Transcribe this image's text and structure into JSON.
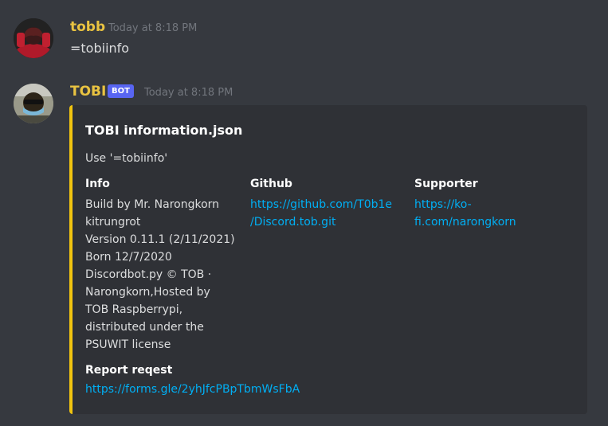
{
  "messages": [
    {
      "author": "tobb",
      "timestamp": "Today at 8:18 PM",
      "content": "=tobiinfo"
    },
    {
      "author": "TOBI",
      "badge": "BOT",
      "timestamp": "Today at 8:18 PM",
      "embed": {
        "accent_color": "#f1c40f",
        "title": "TOBI information.json",
        "description": "Use '=tobiinfo'",
        "fields": [
          {
            "name": "Info",
            "value": "Build by Mr. Narongkorn\nkitrungrot\nVersion 0.11.1 (2/11/2021)\nBorn 12/7/2020\nDiscordbot.py © TOB ·\nNarongkorn,Hosted by\nTOB Raspberrypi,\ndistributed under the\nPSUWIT license"
          },
          {
            "name": "Github",
            "value": "https://github.com/T0b1e\n/Discord.tob.git"
          },
          {
            "name": "Supporter",
            "value": "https://ko-\nfi.com/narongkorn"
          },
          {
            "name": "Report reqest",
            "value": "https://forms.gle/2yhJfcPBpTbmWsFbA"
          }
        ]
      }
    }
  ],
  "colors": {
    "background": "#36393f",
    "embed_background": "#2f3136",
    "username": "#e9c341",
    "link": "#00aff4",
    "bot_badge": "#5865f2"
  }
}
